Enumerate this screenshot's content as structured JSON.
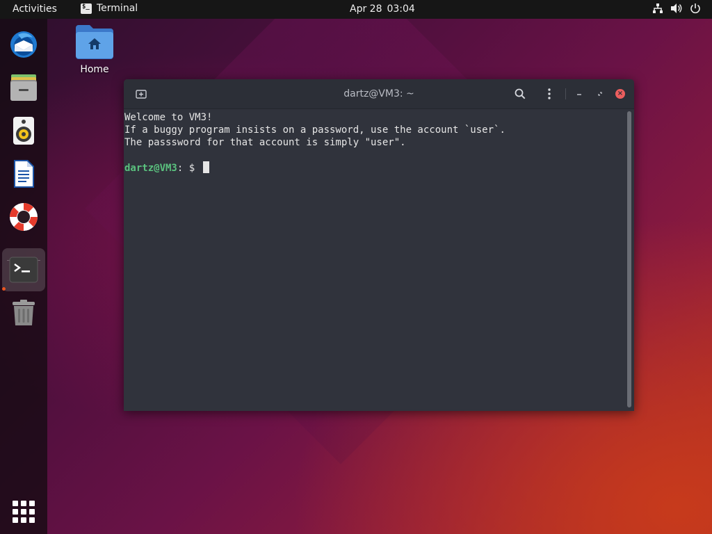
{
  "topbar": {
    "activities": "Activities",
    "app_name": "Terminal",
    "app_icon_glyph": "$_",
    "date": "Apr 28",
    "time": "03:04",
    "tray_icons": [
      "network-icon",
      "volume-icon",
      "power-icon"
    ]
  },
  "desktop": {
    "home_label": "Home"
  },
  "dock": {
    "items": [
      "thunderbird-icon",
      "files-icon",
      "rhythmbox-icon",
      "writer-icon",
      "help-icon",
      "terminal-icon",
      "trash-icon"
    ],
    "active_item": "terminal-icon",
    "show_apps": "show-apps-icon"
  },
  "terminal": {
    "title": "dartz@VM3: ~",
    "lines": [
      "Welcome to VM3!",
      "If a buggy program insists on a password, use the account `user`.",
      "The passsword for that account is simply \"user\"."
    ],
    "prompt_user": "dartz@VM3",
    "prompt_rest": ": $"
  },
  "colors": {
    "accent": "#e95420",
    "prompt_green": "#5ac17e",
    "terminal_bg": "#30333c",
    "close_red": "#ec5e5e"
  }
}
